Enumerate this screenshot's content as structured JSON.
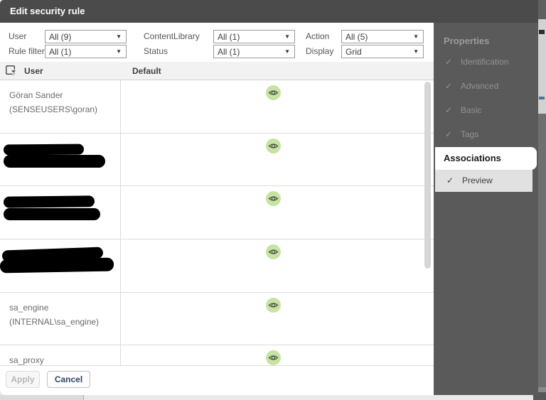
{
  "dialog": {
    "title": "Edit security rule",
    "filters": {
      "user": {
        "label": "User",
        "value": "All (9)"
      },
      "content_library": {
        "label": "ContentLibrary",
        "value": "All (1)"
      },
      "action": {
        "label": "Action",
        "value": "All (5)"
      },
      "rule_filter": {
        "label": "Rule filter",
        "value": "All (1)"
      },
      "status": {
        "label": "Status",
        "value": "All (1)"
      },
      "display": {
        "label": "Display",
        "value": "Grid"
      }
    },
    "table": {
      "columns": {
        "user": "User",
        "default": "Default"
      },
      "rows": [
        {
          "name": "Göran Sander",
          "directory": "(SENSEUSERS\\goran)",
          "redacted": false,
          "default_icon": "eye-badge"
        },
        {
          "name": "",
          "directory": "",
          "redacted": true,
          "default_icon": "eye-badge"
        },
        {
          "name": "",
          "directory": "",
          "redacted": true,
          "default_icon": "eye-badge"
        },
        {
          "name": "",
          "directory": "",
          "redacted": true,
          "default_icon": "eye-badge"
        },
        {
          "name": "sa_engine",
          "directory": "(INTERNAL\\sa_engine)",
          "redacted": false,
          "default_icon": "eye-badge"
        },
        {
          "name": "sa_proxy",
          "directory": "",
          "redacted": false,
          "default_icon": "eye-badge"
        }
      ]
    },
    "footer": {
      "apply_label": "Apply",
      "cancel_label": "Cancel"
    }
  },
  "sidebar": {
    "heading": "Properties",
    "checkmark": "✓",
    "items": [
      {
        "label": "Identification",
        "checked": true,
        "active": false
      },
      {
        "label": "Advanced",
        "checked": true,
        "active": false
      },
      {
        "label": "Basic",
        "checked": true,
        "active": false
      },
      {
        "label": "Tags",
        "checked": true,
        "active": false
      },
      {
        "label": "Associations",
        "checked": false,
        "active": true
      },
      {
        "label": "Preview",
        "checked": true,
        "active": true
      }
    ]
  },
  "icons": {
    "dropdown_arrow": "▼"
  },
  "colors": {
    "title_bar": "#4b4b4b",
    "overlay_panel": "#5a5a5a",
    "eye_badge_bg": "#c7e3a3",
    "grid_header_bg": "#f2f2f2",
    "grid_border": "#dcdcdc",
    "active_tab_bg": "#ffffff",
    "preview_row_bg": "#e1e1e1"
  }
}
